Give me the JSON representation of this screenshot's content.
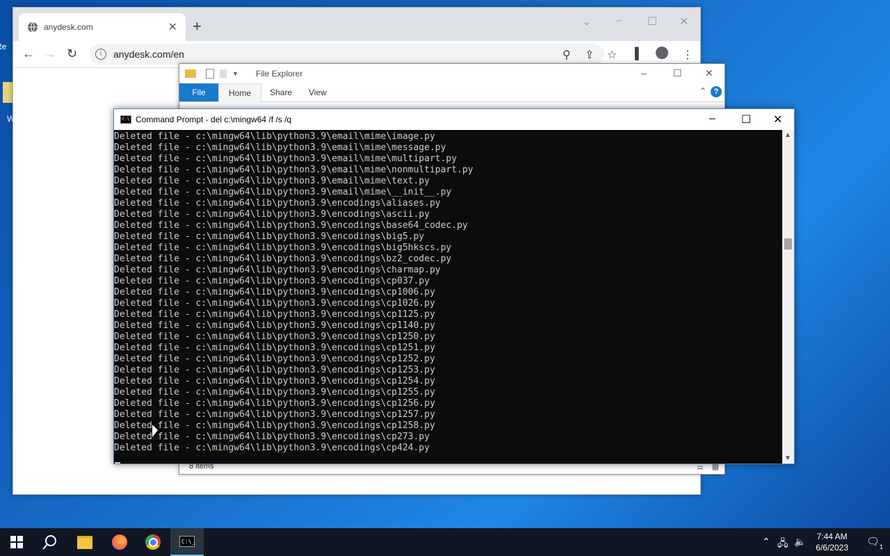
{
  "desktop": {
    "icon1_label": "Re",
    "icon2_label": "W"
  },
  "chrome": {
    "tab_title": "anydesk.com",
    "url": "anydesk.com/en",
    "new_tab": "+",
    "tab_close": "✕"
  },
  "explorer": {
    "title": "File Explorer",
    "tabs": [
      "File",
      "Home",
      "Share",
      "View"
    ],
    "status": "8 items",
    "help": "?"
  },
  "cmd": {
    "title": "Command Prompt - del  c:\\mingw64 /f /s /q",
    "icon_text": "C:\\",
    "lines": [
      "Deleted file - c:\\mingw64\\lib\\python3.9\\email\\mime\\image.py",
      "Deleted file - c:\\mingw64\\lib\\python3.9\\email\\mime\\message.py",
      "Deleted file - c:\\mingw64\\lib\\python3.9\\email\\mime\\multipart.py",
      "Deleted file - c:\\mingw64\\lib\\python3.9\\email\\mime\\nonmultipart.py",
      "Deleted file - c:\\mingw64\\lib\\python3.9\\email\\mime\\text.py",
      "Deleted file - c:\\mingw64\\lib\\python3.9\\email\\mime\\__init__.py",
      "Deleted file - c:\\mingw64\\lib\\python3.9\\encodings\\aliases.py",
      "Deleted file - c:\\mingw64\\lib\\python3.9\\encodings\\ascii.py",
      "Deleted file - c:\\mingw64\\lib\\python3.9\\encodings\\base64_codec.py",
      "Deleted file - c:\\mingw64\\lib\\python3.9\\encodings\\big5.py",
      "Deleted file - c:\\mingw64\\lib\\python3.9\\encodings\\big5hkscs.py",
      "Deleted file - c:\\mingw64\\lib\\python3.9\\encodings\\bz2_codec.py",
      "Deleted file - c:\\mingw64\\lib\\python3.9\\encodings\\charmap.py",
      "Deleted file - c:\\mingw64\\lib\\python3.9\\encodings\\cp037.py",
      "Deleted file - c:\\mingw64\\lib\\python3.9\\encodings\\cp1006.py",
      "Deleted file - c:\\mingw64\\lib\\python3.9\\encodings\\cp1026.py",
      "Deleted file - c:\\mingw64\\lib\\python3.9\\encodings\\cp1125.py",
      "Deleted file - c:\\mingw64\\lib\\python3.9\\encodings\\cp1140.py",
      "Deleted file - c:\\mingw64\\lib\\python3.9\\encodings\\cp1250.py",
      "Deleted file - c:\\mingw64\\lib\\python3.9\\encodings\\cp1251.py",
      "Deleted file - c:\\mingw64\\lib\\python3.9\\encodings\\cp1252.py",
      "Deleted file - c:\\mingw64\\lib\\python3.9\\encodings\\cp1253.py",
      "Deleted file - c:\\mingw64\\lib\\python3.9\\encodings\\cp1254.py",
      "Deleted file - c:\\mingw64\\lib\\python3.9\\encodings\\cp1255.py",
      "Deleted file - c:\\mingw64\\lib\\python3.9\\encodings\\cp1256.py",
      "Deleted file - c:\\mingw64\\lib\\python3.9\\encodings\\cp1257.py",
      "Deleted file - c:\\mingw64\\lib\\python3.9\\encodings\\cp1258.py",
      "Deleted file - c:\\mingw64\\lib\\python3.9\\encodings\\cp273.py",
      "Deleted file - c:\\mingw64\\lib\\python3.9\\encodings\\cp424.py"
    ]
  },
  "taskbar": {
    "time": "7:44 AM",
    "date": "6/6/2023",
    "notification_count": "1",
    "items": [
      "start-icon",
      "search-icon",
      "file-explorer-icon",
      "firefox-icon",
      "chrome-icon",
      "command-prompt-icon"
    ]
  },
  "colors": {
    "accent": "#1979ca",
    "taskbar": "#101722",
    "console_bg": "#0c0c0c",
    "console_fg": "#cccccc"
  }
}
